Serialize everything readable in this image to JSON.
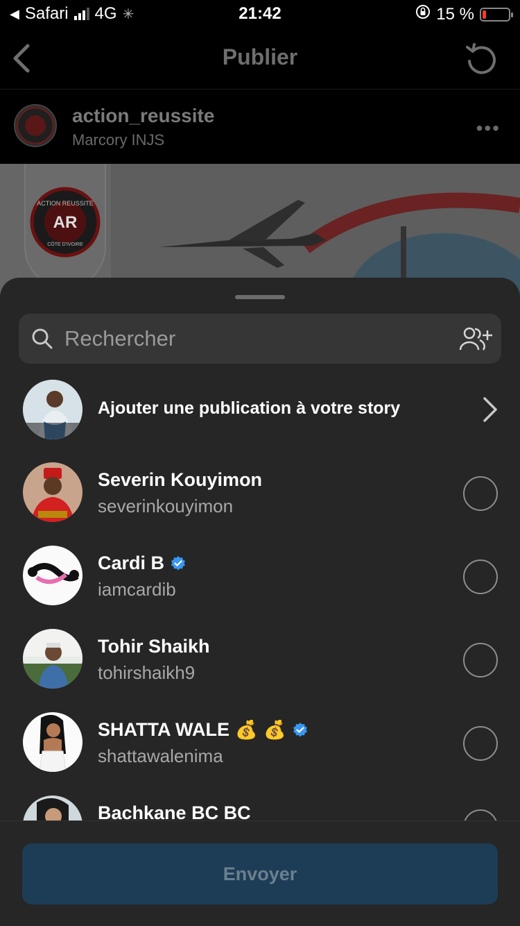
{
  "status_bar": {
    "carrier": "Safari",
    "network": "4G",
    "time": "21:42",
    "battery": "15 %",
    "battery_level": 0.15,
    "battery_color": "#ff3b30"
  },
  "nav": {
    "title": "Publier",
    "back_icon": "chevron-left-icon",
    "refresh_icon": "refresh-icon"
  },
  "post": {
    "username": "action_reussite",
    "location": "Marcory INJS",
    "logo_text": "ACTION REUSSITE",
    "logo_monogram": "AR",
    "logo_subtext": "CÔTE D'IVOIRE"
  },
  "sheet": {
    "search_placeholder": "Rechercher",
    "story_label": "Ajouter une publication à votre story",
    "send_label": "Envoyer",
    "send_color": "#1d3d57"
  },
  "contacts": [
    {
      "name": "Severin Kouyimon",
      "handle": "severinkouyimon",
      "verified": false,
      "emoji": ""
    },
    {
      "name": "Cardi B",
      "handle": "iamcardib",
      "verified": true,
      "emoji": ""
    },
    {
      "name": "Tohir Shaikh",
      "handle": "tohirshaikh9",
      "verified": false,
      "emoji": ""
    },
    {
      "name": "SHATTA WALE",
      "handle": "shattawalenima",
      "verified": true,
      "emoji": "💰 💰"
    },
    {
      "name": "Bachkane BC BC",
      "handle": "",
      "verified": false,
      "emoji": ""
    }
  ],
  "colors": {
    "verified_blue": "#3897f0",
    "sheet_bg": "#262626"
  }
}
